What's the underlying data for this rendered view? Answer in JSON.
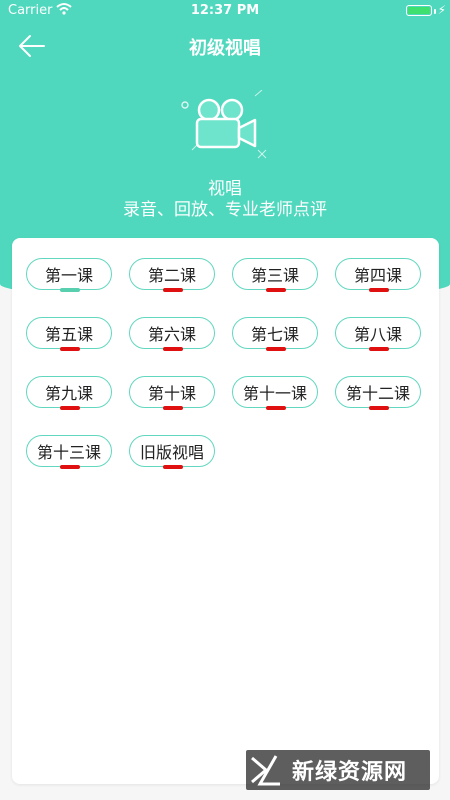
{
  "status": {
    "carrier": "Carrier",
    "time": "12:37 PM"
  },
  "nav": {
    "title": "初级视唱"
  },
  "hero": {
    "title": "视唱",
    "subtitle": "录音、回放、专业老师点评"
  },
  "lessons": [
    {
      "label": "第一课",
      "bar_color": "#58cfae"
    },
    {
      "label": "第二课",
      "bar_color": "#e01010"
    },
    {
      "label": "第三课",
      "bar_color": "#e01010"
    },
    {
      "label": "第四课",
      "bar_color": "#e01010"
    },
    {
      "label": "第五课",
      "bar_color": "#e01010"
    },
    {
      "label": "第六课",
      "bar_color": "#e01010"
    },
    {
      "label": "第七课",
      "bar_color": "#e01010"
    },
    {
      "label": "第八课",
      "bar_color": "#e01010"
    },
    {
      "label": "第九课",
      "bar_color": "#e01010"
    },
    {
      "label": "第十课",
      "bar_color": "#e01010"
    },
    {
      "label": "第十一课",
      "bar_color": "#e01010"
    },
    {
      "label": "第十二课",
      "bar_color": "#e01010"
    },
    {
      "label": "第十三课",
      "bar_color": "#e01010"
    },
    {
      "label": "旧版视唱",
      "bar_color": "#e01010"
    }
  ],
  "watermark": {
    "text": "新绿资源网"
  },
  "colors": {
    "accent": "#4fd8bd",
    "lesson_border": "#62d7c0",
    "active_bar": "#58cfae",
    "inactive_bar": "#e01010"
  }
}
